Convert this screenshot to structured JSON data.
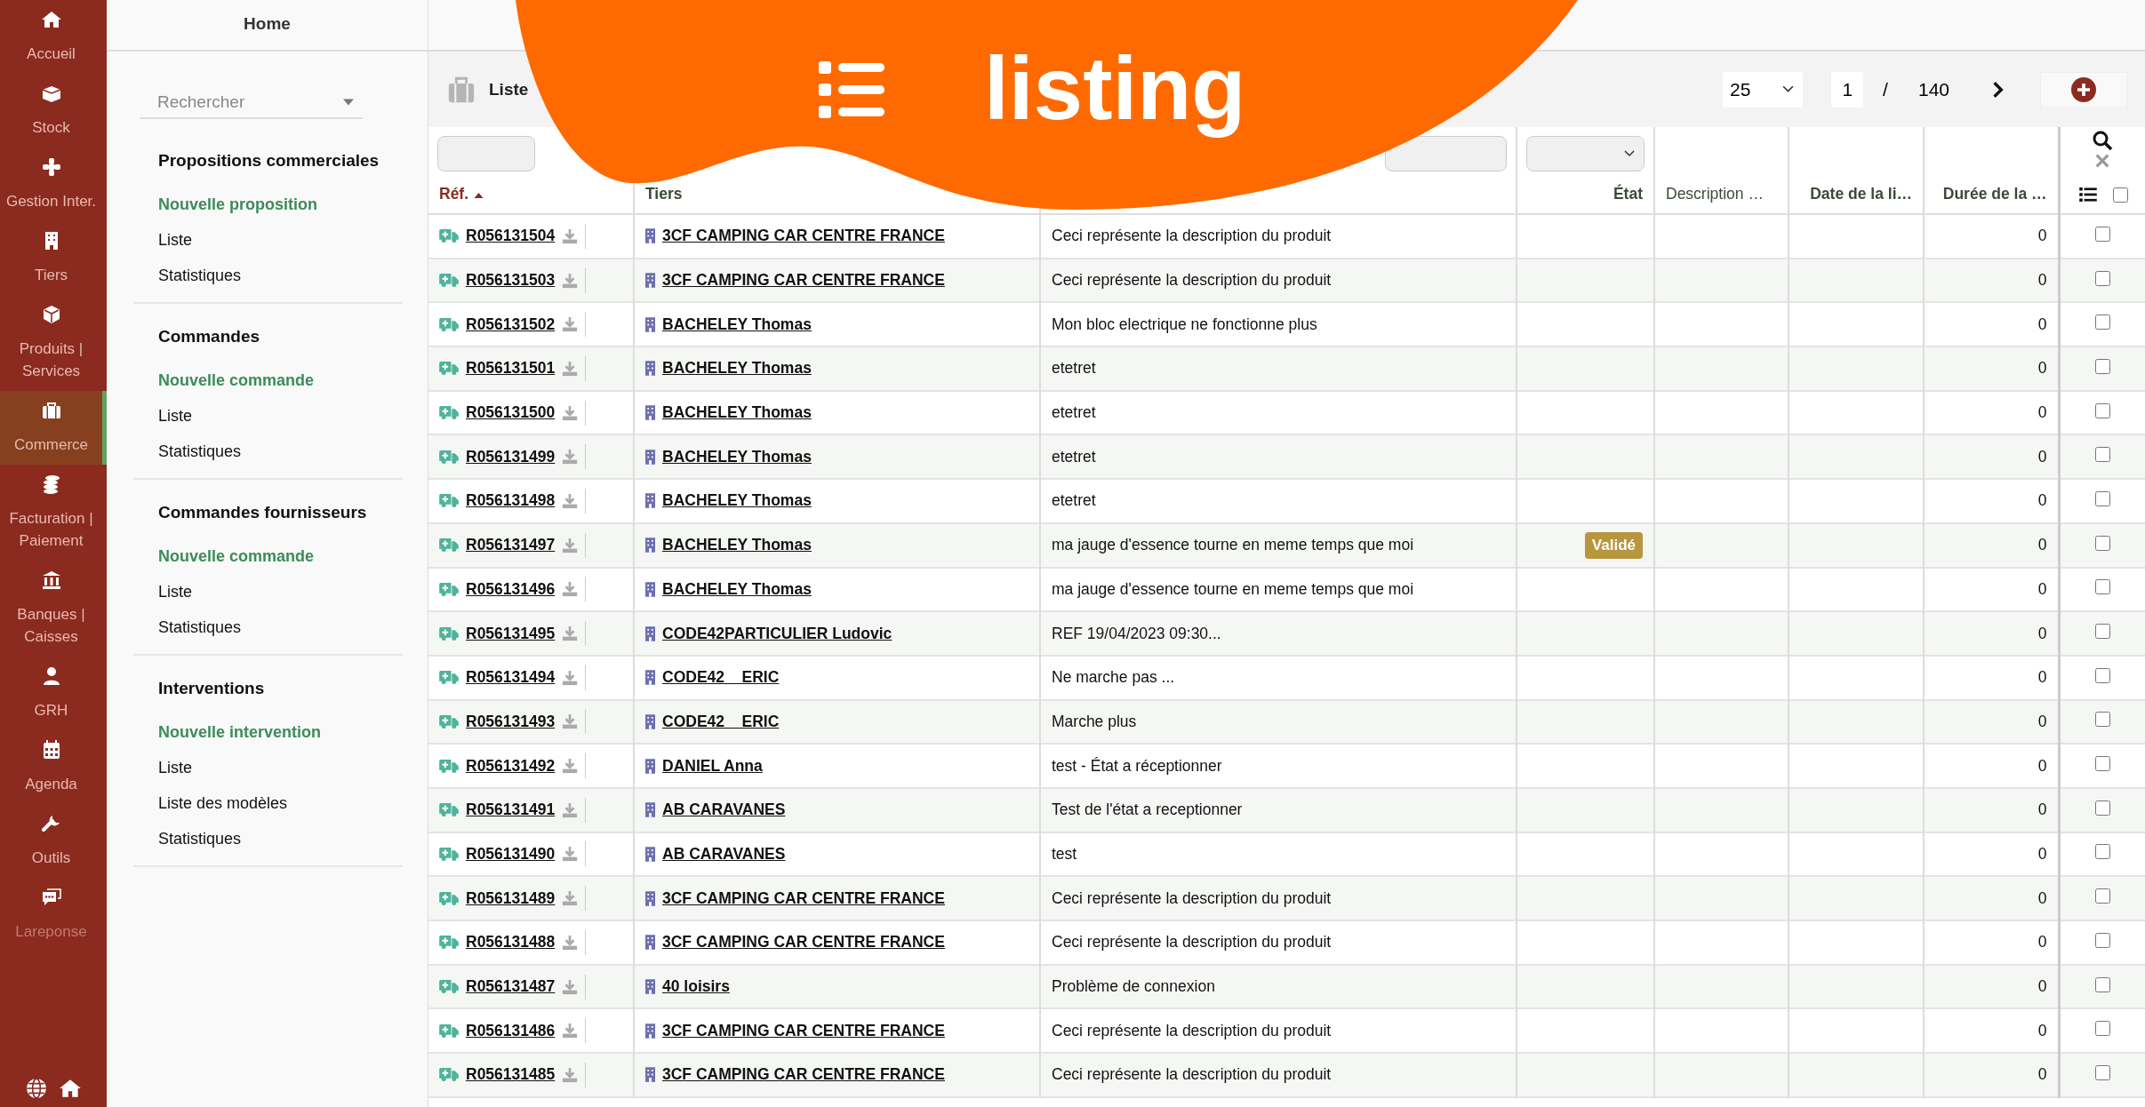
{
  "rail": {
    "items": [
      {
        "label": "Accueil",
        "selected": false,
        "disabled": false
      },
      {
        "label": "Stock",
        "selected": false,
        "disabled": false
      },
      {
        "label": "Gestion Inter.",
        "selected": false,
        "disabled": false
      },
      {
        "label": "Tiers",
        "selected": false,
        "disabled": false
      },
      {
        "label": "Produits | Services",
        "selected": false,
        "disabled": false
      },
      {
        "label": "Commerce",
        "selected": true,
        "disabled": false
      },
      {
        "label": "Facturation | Paiement",
        "selected": false,
        "disabled": false
      },
      {
        "label": "Banques | Caisses",
        "selected": false,
        "disabled": false
      },
      {
        "label": "GRH",
        "selected": false,
        "disabled": false
      },
      {
        "label": "Agenda",
        "selected": false,
        "disabled": false
      },
      {
        "label": "Outils",
        "selected": false,
        "disabled": false
      },
      {
        "label": "Lareponse",
        "selected": false,
        "disabled": true
      }
    ]
  },
  "nav": {
    "title": "Home",
    "search": {
      "placeholder": "Rechercher"
    },
    "sections": [
      {
        "title": "Propositions commerciales",
        "items": [
          {
            "label": "Nouvelle proposition",
            "kind": "create"
          },
          {
            "label": "Liste",
            "kind": "link"
          },
          {
            "label": "Statistiques",
            "kind": "link"
          }
        ]
      },
      {
        "title": "Commandes",
        "items": [
          {
            "label": "Nouvelle commande",
            "kind": "create"
          },
          {
            "label": "Liste",
            "kind": "link"
          },
          {
            "label": "Statistiques",
            "kind": "link"
          }
        ]
      },
      {
        "title": "Commandes fournisseurs",
        "items": [
          {
            "label": "Nouvelle commande",
            "kind": "create"
          },
          {
            "label": "Liste",
            "kind": "link"
          },
          {
            "label": "Statistiques",
            "kind": "link"
          }
        ]
      },
      {
        "title": "Interventions",
        "items": [
          {
            "label": "Nouvelle intervention",
            "kind": "create"
          },
          {
            "label": "Liste",
            "kind": "link"
          },
          {
            "label": "Liste des modèles",
            "kind": "link"
          },
          {
            "label": "Statistiques",
            "kind": "link"
          }
        ]
      }
    ]
  },
  "header": {
    "title": "Liste",
    "per_page": "25",
    "page": "1",
    "separator": "/",
    "total_pages": "140"
  },
  "table": {
    "columns": [
      {
        "label": "Réf.",
        "sorted": true,
        "sortable": true
      },
      {
        "label": "Tiers",
        "sorted": false,
        "sortable": true
      },
      {
        "label": "État",
        "sorted": false,
        "sortable": true
      },
      {
        "label": "Description …",
        "sorted": false,
        "sortable": false
      },
      {
        "label": "Date de la li…",
        "sorted": false,
        "sortable": true
      },
      {
        "label": "Durée de la …",
        "sorted": false,
        "sortable": true
      }
    ],
    "select_all": false,
    "rows": [
      {
        "ref": "R056131504",
        "tiers": "3CF CAMPING CAR CENTRE FRANCE",
        "description": "Ceci représente la description du produit",
        "duree": "0",
        "checked": false
      },
      {
        "ref": "R056131503",
        "tiers": "3CF CAMPING CAR CENTRE FRANCE",
        "description": "Ceci représente la description du produit",
        "duree": "0",
        "checked": false
      },
      {
        "ref": "R056131502",
        "tiers": "BACHELEY Thomas",
        "description": "Mon bloc electrique ne fonctionne plus",
        "duree": "0",
        "checked": false
      },
      {
        "ref": "R056131501",
        "tiers": "BACHELEY Thomas",
        "description": "etetret",
        "duree": "0",
        "checked": false
      },
      {
        "ref": "R056131500",
        "tiers": "BACHELEY Thomas",
        "description": "etetret",
        "duree": "0",
        "checked": false
      },
      {
        "ref": "R056131499",
        "tiers": "BACHELEY Thomas",
        "description": "etetret",
        "duree": "0",
        "checked": false
      },
      {
        "ref": "R056131498",
        "tiers": "BACHELEY Thomas",
        "description": "etetret",
        "duree": "0",
        "checked": false
      },
      {
        "ref": "R056131497",
        "tiers": "BACHELEY Thomas",
        "description": "ma jauge d'essence tourne en meme temps que moi",
        "status": "Validé",
        "duree": "0",
        "checked": false
      },
      {
        "ref": "R056131496",
        "tiers": "BACHELEY Thomas",
        "description": "ma jauge d'essence tourne en meme temps que moi",
        "duree": "0",
        "checked": false
      },
      {
        "ref": "R056131495",
        "tiers": "CODE42PARTICULIER Ludovic",
        "description": "REF 19/04/2023 09:30...",
        "duree": "0",
        "checked": false
      },
      {
        "ref": "R056131494",
        "tiers": "CODE42 _ ERIC",
        "description": "Ne marche pas ...",
        "duree": "0",
        "checked": false
      },
      {
        "ref": "R056131493",
        "tiers": "CODE42 _ ERIC",
        "description": "Marche plus",
        "duree": "0",
        "checked": false
      },
      {
        "ref": "R056131492",
        "tiers": "DANIEL Anna",
        "description": "test - État a réceptionner",
        "duree": "0",
        "checked": false
      },
      {
        "ref": "R056131491",
        "tiers": "AB CARAVANES",
        "description": "Test de l'état a receptionner",
        "duree": "0",
        "checked": false
      },
      {
        "ref": "R056131490",
        "tiers": "AB CARAVANES",
        "description": "test",
        "duree": "0",
        "checked": false
      },
      {
        "ref": "R056131489",
        "tiers": "3CF CAMPING CAR CENTRE FRANCE",
        "description": "Ceci représente la description du produit",
        "duree": "0",
        "checked": false
      },
      {
        "ref": "R056131488",
        "tiers": "3CF CAMPING CAR CENTRE FRANCE",
        "description": "Ceci représente la description du produit",
        "duree": "0",
        "checked": false
      },
      {
        "ref": "R056131487",
        "tiers": "40 loisirs",
        "description": "Problème de connexion",
        "duree": "0",
        "checked": false
      },
      {
        "ref": "R056131486",
        "tiers": "3CF CAMPING CAR CENTRE FRANCE",
        "description": "Ceci représente la description du produit",
        "duree": "0",
        "checked": false
      },
      {
        "ref": "R056131485",
        "tiers": "3CF CAMPING CAR CENTRE FRANCE",
        "description": "Ceci représente la description du produit",
        "duree": "0",
        "checked": false
      }
    ]
  },
  "banner": {
    "title": "listing"
  }
}
